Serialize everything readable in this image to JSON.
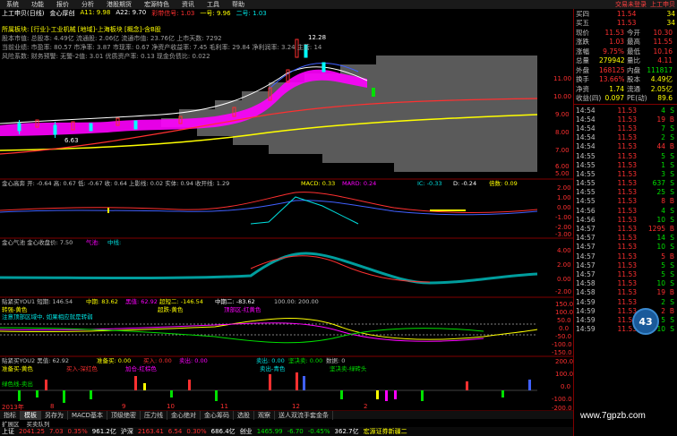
{
  "menu": {
    "items": [
      "系统",
      "功能",
      "报价",
      "分析",
      "港股期货",
      "宏源特色",
      "资讯",
      "工具",
      "帮助"
    ],
    "login_text": "交易未登录",
    "stock_name": "上工申贝"
  },
  "title": {
    "stock": "上工申贝(日线)",
    "indicator": "金心厚创",
    "a11": "A11: 9.98",
    "a22": "A22: 9.70",
    "extra1": "彩带信号: 1.03",
    "extra2": "一号: 9.96",
    "extra3": "二号: 1.03"
  },
  "info_lines": {
    "line1": "所属板块: [行业]-工业机械 [地域]-上海板块 [概念]-含B股",
    "line2": "股本市值: 总股本: 4.49亿 流通股: 2.06亿 流通市值: 23.76亿 上市天数: 7292",
    "line3": "当前业绩: 市盈率: 80.57 市净率: 3.87 市现率: 0.67 净资产收益率: 7.45 毛利率: 29.84 净利润率: 3.24 主营: 14",
    "line4": "风险系数: 财务预警: 无警-2值: 3.01 优质资产率: 0.13 现金负债比: 0.022"
  },
  "main_chart": {
    "high_label": "12.28",
    "low_label": "6.63",
    "price_axis": [
      "11.00",
      "10.00",
      "9.00",
      "8.00",
      "7.00",
      "6.00",
      "5.00"
    ]
  },
  "panel1": {
    "title": "金心高奔 开: -0.64 高: 0.67 低: -0.67 收: 0.64 上影线: 0.02 实体: 0.94 收开线: 1.29",
    "macd": "MACD: 0.33",
    "mard": "MARD: 0.24",
    "ic": "IC: -0.33",
    "d": "D: -0.24",
    "times": "倍数: 0.09",
    "axis": [
      "2.00",
      "1.00",
      "0.00",
      "-1.00",
      "-2.00",
      "-3.00"
    ]
  },
  "panel2": {
    "title": "金心气池 金心收盘价: 7.50",
    "sub1": "气池:",
    "sub2": "中线:",
    "axis": [
      "4.00",
      "2.00",
      "0.00",
      "-2.00"
    ]
  },
  "panel3": {
    "title": "贴紧买YOU1 短期: 146.54",
    "mid": "中期: 83.62",
    "v1": "黑值: 62.92",
    "v2": "超短二: -146.54",
    "v3": "中期二: -83.62",
    "v4": "100.00: 200.00",
    "note1": "转强-黄色",
    "note2": "注意顶部区域中, 如果相应就是转弱",
    "note3": "超跌-黄色",
    "note4": "顶部区-红黄色",
    "axis": [
      "150.0",
      "100.0",
      "50.0",
      "0.0",
      "-50.0",
      "-100.0",
      "-150.0"
    ]
  },
  "panel4": {
    "title": "贴紧买YOU2 黑值: 62.92",
    "v1": "准备买: 0.00",
    "v2": "买入: 0.00",
    "v3": "卖出: 0.00",
    "v4": "卖出: 0.00",
    "v5": "坚决卖: 0.00",
    "v6": "数据: 0",
    "note1": "准备买-黄色",
    "note2": "买入-深红色",
    "note3": "加仓-红棕色",
    "note4": "卖出-青色",
    "note5": "坚决卖-绿砖头",
    "note6": "绿色线-卖出",
    "axis": [
      "200.0",
      "100.0",
      "0.0",
      "-100.0",
      "-200.0"
    ]
  },
  "x_axis": [
    "2013年",
    "8",
    "9",
    "10",
    "11",
    "12",
    "2"
  ],
  "tabs": [
    "指标",
    "模板",
    "另存为",
    "MACD基本",
    "顶级绝密",
    "压力线",
    "金心绝对",
    "金心筹码",
    "选股",
    "观察",
    "送人双流手套金条"
  ],
  "subtabs": [
    "扩展区",
    "买卖队列"
  ],
  "status": {
    "sh_label": "上证",
    "sh_price": "2041.25",
    "sh_chg": "7.03",
    "sh_pct": "0.35%",
    "sh_vol": "961.2亿",
    "sz_label": "沪深",
    "sz_price": "2163.41",
    "sz_chg": "6.54",
    "sz_pct": "0.30%",
    "sz_vol": "686.4亿",
    "cy_label": "创业",
    "cy_price": "1465.99",
    "cy_chg": "-6.70",
    "cy_pct": "-0.45%",
    "cy_vol": "362.7亿",
    "broker": "宏源证券新疆二"
  },
  "quote": {
    "rows": [
      {
        "k": "买四",
        "p": "11.54",
        "v": "34"
      },
      {
        "k": "买五",
        "p": "11.53",
        "v": "34"
      },
      {
        "k": "现价",
        "p": "11.53",
        "k2": "今开",
        "v": "10.30"
      },
      {
        "k": "涨跌",
        "p": "1.03",
        "k2": "最高",
        "v": "11.55"
      },
      {
        "k": "涨幅",
        "p": "9.75%",
        "k2": "最低",
        "v": "10.16"
      },
      {
        "k": "总量",
        "p": "279942",
        "k2": "量比",
        "v": "4.11"
      },
      {
        "k": "外盘",
        "p": "168125",
        "k2": "内盘",
        "v": "111817"
      },
      {
        "k": "换手",
        "p": "13.66%",
        "k2": "股本",
        "v": "4.49亿"
      },
      {
        "k": "净资",
        "p": "1.74",
        "k2": "流通",
        "v": "2.05亿"
      },
      {
        "k": "收益(四)",
        "p": "0.097",
        "k2": "PE(动)",
        "v": "89.6"
      }
    ],
    "ticks": [
      {
        "t": "14:54",
        "p": "11.53",
        "v": "4",
        "d": "S"
      },
      {
        "t": "14:54",
        "p": "11.53",
        "v": "19",
        "d": "B"
      },
      {
        "t": "14:54",
        "p": "11.53",
        "v": "7",
        "d": "S"
      },
      {
        "t": "14:54",
        "p": "11.53",
        "v": "2",
        "d": "S"
      },
      {
        "t": "14:54",
        "p": "11.53",
        "v": "44",
        "d": "B"
      },
      {
        "t": "14:55",
        "p": "11.53",
        "v": "5",
        "d": "S"
      },
      {
        "t": "14:55",
        "p": "11.53",
        "v": "1",
        "d": "S"
      },
      {
        "t": "14:55",
        "p": "11.53",
        "v": "3",
        "d": "S"
      },
      {
        "t": "14:55",
        "p": "11.53",
        "v": "637",
        "d": "S"
      },
      {
        "t": "14:55",
        "p": "11.53",
        "v": "25",
        "d": "S"
      },
      {
        "t": "14:55",
        "p": "11.53",
        "v": "8",
        "d": "B"
      },
      {
        "t": "14:56",
        "p": "11.53",
        "v": "4",
        "d": "S"
      },
      {
        "t": "14:56",
        "p": "11.53",
        "v": "10",
        "d": "S"
      },
      {
        "t": "14:57",
        "p": "11.53",
        "v": "1295",
        "d": "B"
      },
      {
        "t": "14:57",
        "p": "11.53",
        "v": "14",
        "d": "S"
      },
      {
        "t": "14:57",
        "p": "11.53",
        "v": "10",
        "d": "S"
      },
      {
        "t": "14:57",
        "p": "11.53",
        "v": "5",
        "d": "B"
      },
      {
        "t": "14:57",
        "p": "11.53",
        "v": "5",
        "d": "S"
      },
      {
        "t": "14:57",
        "p": "11.53",
        "v": "5",
        "d": "S"
      },
      {
        "t": "14:58",
        "p": "11.53",
        "v": "10",
        "d": "S"
      },
      {
        "t": "14:58",
        "p": "11.53",
        "v": "19",
        "d": "B"
      },
      {
        "t": "14:59",
        "p": "11.53",
        "v": "2",
        "d": "S"
      },
      {
        "t": "14:59",
        "p": "11.53",
        "v": "2",
        "d": "B"
      },
      {
        "t": "14:59",
        "p": "11.53",
        "v": "5",
        "d": "S"
      },
      {
        "t": "14:59",
        "p": "11.53",
        "v": "10",
        "d": "S"
      }
    ]
  },
  "badge": "43",
  "watermark": "www.7gpzb.com",
  "colors": {
    "up": "#ff3030",
    "down": "#00e000",
    "accent": "#ffff00",
    "magenta": "#ff00ff"
  }
}
